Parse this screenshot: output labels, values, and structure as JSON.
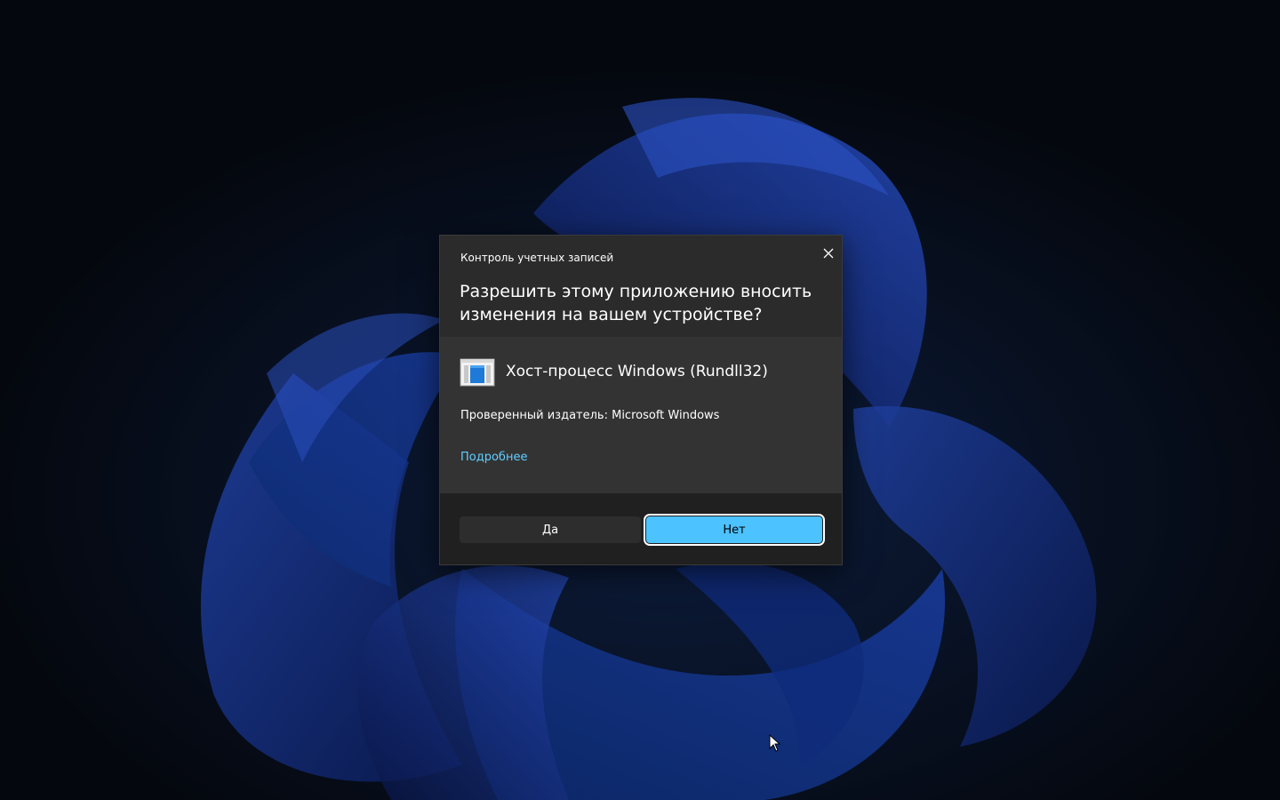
{
  "dialog": {
    "caption": "Контроль учетных записей",
    "question": "Разрешить этому приложению вносить изменения на вашем устройстве?",
    "app_name": "Хост-процесс Windows (Rundll32)",
    "app_icon": "window-app-icon",
    "publisher": "Проверенный издатель: Microsoft Windows",
    "details_link": "Подробнее",
    "close_icon": "close-icon"
  },
  "buttons": {
    "yes_label": "Да",
    "no_label": "Нет"
  },
  "colors": {
    "accent": "#4cc2ff",
    "link": "#60cdff",
    "dialog_bg": "#2b2b2b",
    "body_bg": "#333333",
    "footer_bg": "#202020"
  }
}
